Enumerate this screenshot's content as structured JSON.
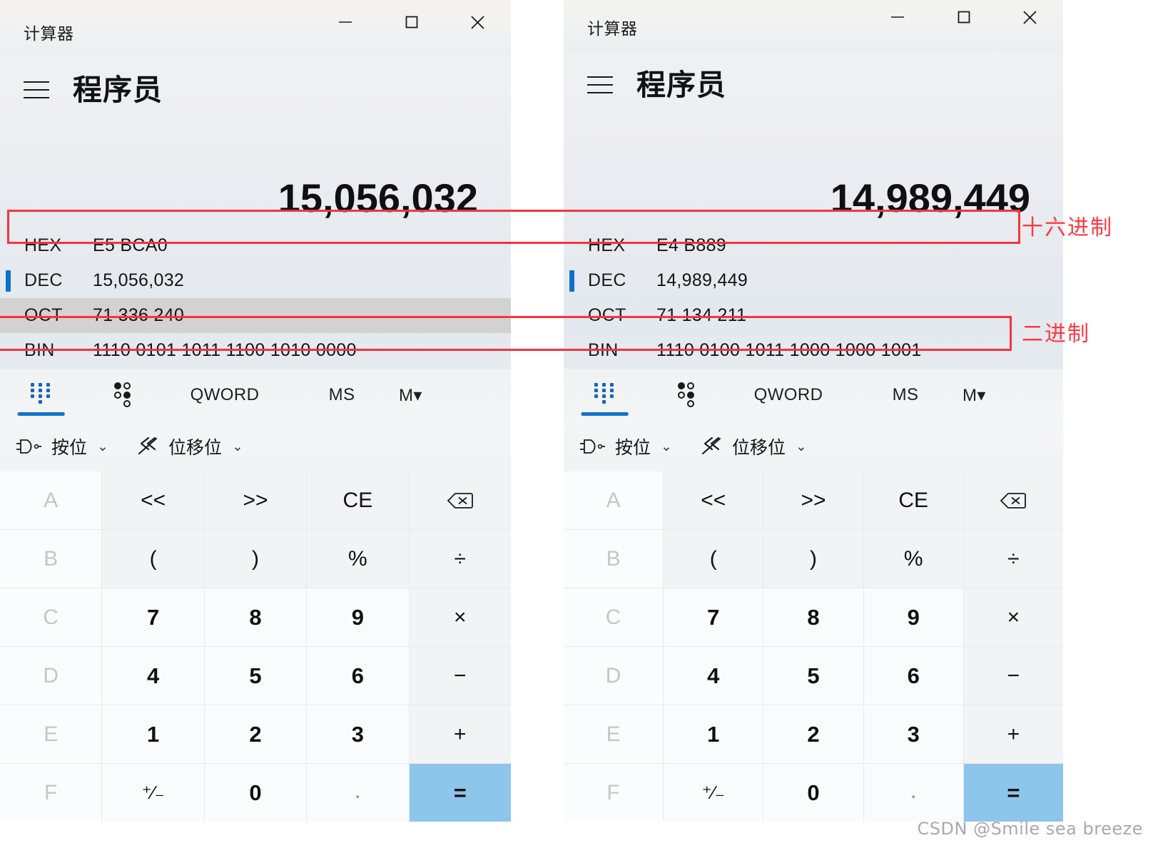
{
  "colors": {
    "accent_blue": "#0d72c7",
    "annotation_red": "#f5333f",
    "equals_blue": "#8ec5ea",
    "row_hover_gray": "#d2d2d2"
  },
  "windows": [
    {
      "id": "left",
      "titlebar": {
        "title": "计算器",
        "minimize": "minimize-icon",
        "maximize": "maximize-icon",
        "close": "close-icon"
      },
      "header": {
        "menu_icon": "hamburger-menu-icon",
        "mode_title": "程序员"
      },
      "display": {
        "value": "15,056,032"
      },
      "bases": [
        {
          "label": "HEX",
          "value": "E5 BCA0",
          "selected": false,
          "hovered": false
        },
        {
          "label": "DEC",
          "value": "15,056,032",
          "selected": true,
          "hovered": false
        },
        {
          "label": "OCT",
          "value": "71 336 240",
          "selected": false,
          "hovered": true
        },
        {
          "label": "BIN",
          "value": "1110 0101 1011 1100 1010 0000",
          "selected": false,
          "hovered": false
        }
      ],
      "tabs": [
        {
          "name": "keypad",
          "label": "",
          "icon": "keypad-grid-icon",
          "selected": true,
          "disabled": false
        },
        {
          "name": "bits",
          "label": "",
          "icon": "bit-toggle-icon",
          "selected": false,
          "disabled": false
        },
        {
          "name": "qword",
          "label": "QWORD",
          "icon": "",
          "selected": false,
          "disabled": false
        },
        {
          "name": "ms",
          "label": "MS",
          "icon": "",
          "selected": false,
          "disabled": false
        },
        {
          "name": "m",
          "label": "M",
          "icon": "memory-dropdown-icon",
          "selected": false,
          "disabled": true
        }
      ],
      "dropdowns": [
        {
          "name": "bitwise",
          "label": "按位",
          "icon": "logic-gate-icon",
          "chevron": "⌄"
        },
        {
          "name": "bitshift",
          "label": "位移位",
          "icon": "bit-shift-icon",
          "chevron": "⌄"
        }
      ],
      "keypad": [
        {
          "label": "A",
          "kind": "dim"
        },
        {
          "label": "<<",
          "kind": "op"
        },
        {
          "label": ">>",
          "kind": "op"
        },
        {
          "label": "CE",
          "kind": "op"
        },
        {
          "label": "",
          "kind": "op",
          "icon": "backspace-icon"
        },
        {
          "label": "B",
          "kind": "dim"
        },
        {
          "label": "(",
          "kind": "op"
        },
        {
          "label": ")",
          "kind": "op"
        },
        {
          "label": "%",
          "kind": "op"
        },
        {
          "label": "÷",
          "kind": "op"
        },
        {
          "label": "C",
          "kind": "dim"
        },
        {
          "label": "7",
          "kind": "digit"
        },
        {
          "label": "8",
          "kind": "digit"
        },
        {
          "label": "9",
          "kind": "digit"
        },
        {
          "label": "×",
          "kind": "op"
        },
        {
          "label": "D",
          "kind": "dim"
        },
        {
          "label": "4",
          "kind": "digit"
        },
        {
          "label": "5",
          "kind": "digit"
        },
        {
          "label": "6",
          "kind": "digit"
        },
        {
          "label": "−",
          "kind": "op"
        },
        {
          "label": "E",
          "kind": "dim"
        },
        {
          "label": "1",
          "kind": "digit"
        },
        {
          "label": "2",
          "kind": "digit"
        },
        {
          "label": "3",
          "kind": "digit"
        },
        {
          "label": "+",
          "kind": "op"
        },
        {
          "label": "F",
          "kind": "dim"
        },
        {
          "label": "⁺∕₋",
          "kind": "small"
        },
        {
          "label": "0",
          "kind": "digit"
        },
        {
          "label": ".",
          "kind": "dot"
        },
        {
          "label": "=",
          "kind": "equals"
        }
      ]
    },
    {
      "id": "right",
      "titlebar": {
        "title": "计算器",
        "minimize": "minimize-icon",
        "maximize": "maximize-icon",
        "close": "close-icon"
      },
      "header": {
        "menu_icon": "hamburger-menu-icon",
        "mode_title": "程序员"
      },
      "display": {
        "value": "14,989,449"
      },
      "bases": [
        {
          "label": "HEX",
          "value": "E4 B889",
          "selected": false,
          "hovered": false
        },
        {
          "label": "DEC",
          "value": "14,989,449",
          "selected": true,
          "hovered": false
        },
        {
          "label": "OCT",
          "value": "71 134 211",
          "selected": false,
          "hovered": false
        },
        {
          "label": "BIN",
          "value": "1110 0100 1011 1000 1000 1001",
          "selected": false,
          "hovered": false
        }
      ],
      "tabs": [
        {
          "name": "keypad",
          "label": "",
          "icon": "keypad-grid-icon",
          "selected": true,
          "disabled": false
        },
        {
          "name": "bits",
          "label": "",
          "icon": "bit-toggle-icon",
          "selected": false,
          "disabled": false
        },
        {
          "name": "qword",
          "label": "QWORD",
          "icon": "",
          "selected": false,
          "disabled": false
        },
        {
          "name": "ms",
          "label": "MS",
          "icon": "",
          "selected": false,
          "disabled": false
        },
        {
          "name": "m",
          "label": "M",
          "icon": "memory-dropdown-icon",
          "selected": false,
          "disabled": true
        }
      ],
      "dropdowns": [
        {
          "name": "bitwise",
          "label": "按位",
          "icon": "logic-gate-icon",
          "chevron": "⌄"
        },
        {
          "name": "bitshift",
          "label": "位移位",
          "icon": "bit-shift-icon",
          "chevron": "⌄"
        }
      ],
      "keypad": [
        {
          "label": "A",
          "kind": "dim"
        },
        {
          "label": "<<",
          "kind": "op"
        },
        {
          "label": ">>",
          "kind": "op"
        },
        {
          "label": "CE",
          "kind": "op"
        },
        {
          "label": "",
          "kind": "op",
          "icon": "backspace-icon"
        },
        {
          "label": "B",
          "kind": "dim"
        },
        {
          "label": "(",
          "kind": "op"
        },
        {
          "label": ")",
          "kind": "op"
        },
        {
          "label": "%",
          "kind": "op"
        },
        {
          "label": "÷",
          "kind": "op"
        },
        {
          "label": "C",
          "kind": "dim"
        },
        {
          "label": "7",
          "kind": "digit"
        },
        {
          "label": "8",
          "kind": "digit"
        },
        {
          "label": "9",
          "kind": "digit"
        },
        {
          "label": "×",
          "kind": "op"
        },
        {
          "label": "D",
          "kind": "dim"
        },
        {
          "label": "4",
          "kind": "digit"
        },
        {
          "label": "5",
          "kind": "digit"
        },
        {
          "label": "6",
          "kind": "digit"
        },
        {
          "label": "−",
          "kind": "op"
        },
        {
          "label": "E",
          "kind": "dim"
        },
        {
          "label": "1",
          "kind": "digit"
        },
        {
          "label": "2",
          "kind": "digit"
        },
        {
          "label": "3",
          "kind": "digit"
        },
        {
          "label": "+",
          "kind": "op"
        },
        {
          "label": "F",
          "kind": "dim"
        },
        {
          "label": "⁺∕₋",
          "kind": "small"
        },
        {
          "label": "0",
          "kind": "digit"
        },
        {
          "label": ".",
          "kind": "dot"
        },
        {
          "label": "=",
          "kind": "equals"
        }
      ]
    }
  ],
  "annotations": [
    {
      "name": "hex-annotation",
      "label": "十六进制",
      "target": "HEX"
    },
    {
      "name": "bin-annotation",
      "label": "二进制",
      "target": "BIN"
    }
  ],
  "watermark": "CSDN @Smile sea breeze"
}
